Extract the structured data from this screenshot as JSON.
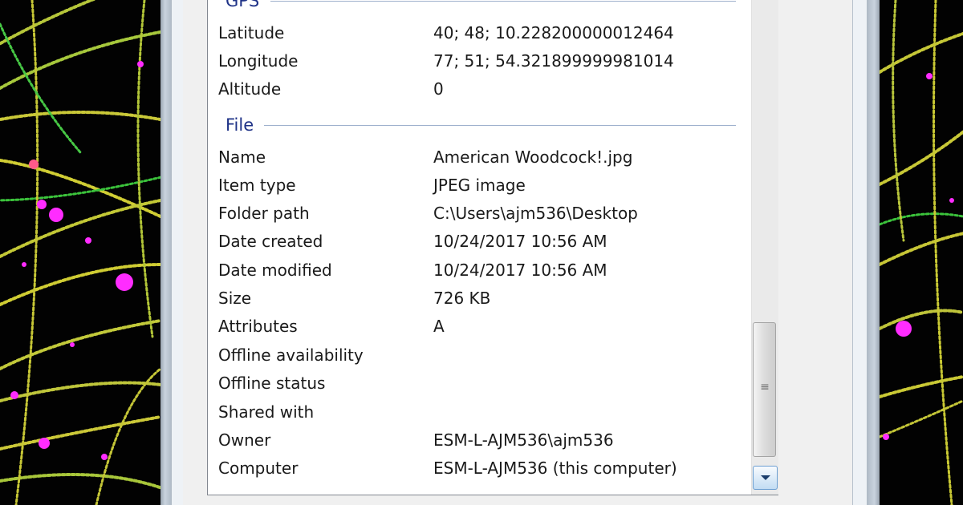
{
  "groups": {
    "gps": {
      "label": "GPS",
      "rows": [
        {
          "name": "Latitude",
          "value": "40; 48; 10.228200000012464"
        },
        {
          "name": "Longitude",
          "value": "77; 51; 54.321899999981014"
        },
        {
          "name": "Altitude",
          "value": "0"
        }
      ]
    },
    "file": {
      "label": "File",
      "rows": [
        {
          "name": "Name",
          "value": "American Woodcock!.jpg"
        },
        {
          "name": "Item type",
          "value": "JPEG image"
        },
        {
          "name": "Folder path",
          "value": "C:\\Users\\ajm536\\Desktop"
        },
        {
          "name": "Date created",
          "value": "10/24/2017 10:56 AM"
        },
        {
          "name": "Date modified",
          "value": "10/24/2017 10:56 AM"
        },
        {
          "name": "Size",
          "value": "726 KB"
        },
        {
          "name": "Attributes",
          "value": "A"
        },
        {
          "name": "Offline availability",
          "value": ""
        },
        {
          "name": "Offline status",
          "value": ""
        },
        {
          "name": "Shared with",
          "value": ""
        },
        {
          "name": "Owner",
          "value": "ESM-L-AJM536\\ajm536"
        },
        {
          "name": "Computer",
          "value": "ESM-L-AJM536 (this computer)"
        }
      ]
    }
  },
  "scrollbar": {
    "grip_icon": "grip-lines-icon",
    "down_icon": "chevron-down-icon"
  },
  "colors": {
    "group_header": "#1e3287",
    "group_line": "#9fb1cd",
    "filament_yellow": "#c8c832",
    "filament_green": "#3ccc3c",
    "spot_magenta": "#ff2cff"
  }
}
